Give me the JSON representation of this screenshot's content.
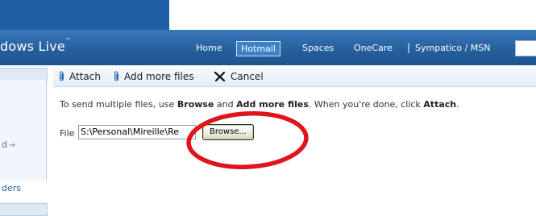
{
  "window": {
    "brand": "dows Live",
    "brand_mark": "™"
  },
  "nav": {
    "links": [
      "Home",
      "Hotmail",
      "Spaces",
      "OneCare",
      "Sympatico / MSN"
    ],
    "active": "Hotmail",
    "separator": "|"
  },
  "sidebar": {
    "item1": "d",
    "item2": "ders"
  },
  "toolbar": {
    "attach": "Attach",
    "add_more": "Add more files",
    "cancel": "Cancel"
  },
  "instruction": {
    "p1": "To send multiple files, use ",
    "b1": "Browse",
    "p2": " and ",
    "b2": "Add more files",
    "p3": ". When you're done, click ",
    "b3": "Attach",
    "p4": "."
  },
  "file": {
    "label": "File",
    "value": "S:\\Personal\\Mireille\\Re",
    "browse_label": "Browse..."
  },
  "colors": {
    "navbar": "#255f9e",
    "highlight_circle": "#e0141c"
  },
  "icons": [
    "paperclip-icon",
    "paperclip-icon",
    "close-x-icon",
    "arrow-right-icon"
  ]
}
